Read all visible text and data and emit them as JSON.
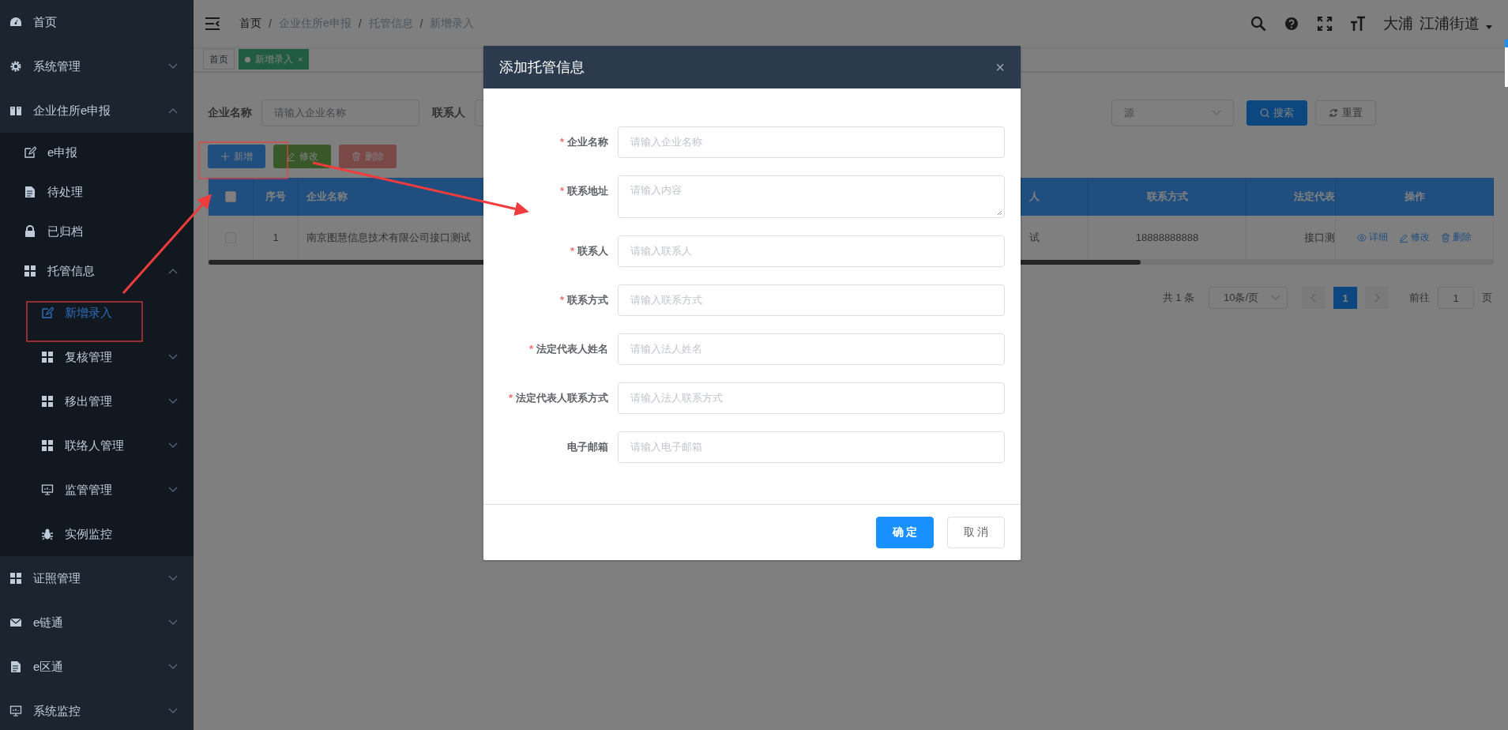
{
  "sidebar": {
    "items": [
      {
        "label": "首页",
        "selected": false
      },
      {
        "label": "系统管理",
        "selected": false,
        "expanded": false
      },
      {
        "label": "企业住所e申报",
        "selected": false,
        "expanded": true,
        "children": [
          {
            "label": "e申报",
            "selected": false
          },
          {
            "label": "待处理",
            "selected": false
          },
          {
            "label": "已归档",
            "selected": false
          },
          {
            "label": "托管信息",
            "selected": false,
            "expanded": true,
            "children": [
              {
                "label": "新增录入",
                "selected": true
              },
              {
                "label": "复核管理",
                "selected": false,
                "expanded": false
              },
              {
                "label": "移出管理",
                "selected": false,
                "expanded": false
              },
              {
                "label": "联络人管理",
                "selected": false,
                "expanded": false
              },
              {
                "label": "监管管理",
                "selected": false,
                "expanded": false
              },
              {
                "label": "实例监控",
                "selected": false
              }
            ]
          }
        ]
      },
      {
        "label": "证照管理",
        "selected": false,
        "expanded": false
      },
      {
        "label": "e链通",
        "selected": false,
        "expanded": false
      },
      {
        "label": "e区通",
        "selected": false,
        "expanded": false
      },
      {
        "label": "系统监控",
        "selected": false,
        "expanded": false
      }
    ]
  },
  "navbar": {
    "breadcrumbs": [
      "首页",
      "企业住所e申报",
      "托管信息",
      "新增录入"
    ],
    "separator": "/",
    "user": {
      "district": "大浦",
      "street": "江浦街道"
    }
  },
  "tags": [
    {
      "label": "首页",
      "selected": false
    },
    {
      "label": "新增录入",
      "selected": true,
      "close": "×"
    }
  ],
  "filters": [
    {
      "kind": "input",
      "label": "企业名称",
      "placeholder": "请输入企业名称"
    },
    {
      "kind": "input",
      "label": "联系人"
    },
    {
      "kind": "select",
      "placeholder": "源"
    }
  ],
  "filter_buttons": [
    {
      "label": "搜索",
      "kind": "primary"
    },
    {
      "label": "重置",
      "kind": "default"
    }
  ],
  "toolbar": [
    {
      "label": "新增",
      "kind": "primary",
      "disabled": false
    },
    {
      "label": "修改",
      "kind": "success",
      "disabled": true
    },
    {
      "label": "删除",
      "kind": "danger",
      "disabled": true
    }
  ],
  "table": {
    "select_all": {
      "checked": false
    },
    "columns": [
      "序号",
      "企业名称",
      "人",
      "联系方式",
      "法定代表",
      "操作"
    ],
    "rows": [
      {
        "checked": false,
        "cells": [
          "1",
          "南京图慧信息技术有限公司接口测试",
          "试",
          "18888888888",
          "接口测"
        ],
        "actions": [
          "详细",
          "修改",
          "删除"
        ]
      }
    ]
  },
  "pagination": {
    "total": "共 1 条",
    "page_size": "10条/页",
    "pages": [
      {
        "label": "1",
        "selected": true
      }
    ],
    "goto_label": "前往",
    "goto_value": "1",
    "goto_suffix": "页"
  },
  "modal": {
    "title": "添加托管信息",
    "close": "×",
    "required_mark": "*",
    "fields": [
      {
        "kind": "input",
        "label": "企业名称",
        "required": true,
        "placeholder": "请输入企业名称"
      },
      {
        "kind": "textarea",
        "label": "联系地址",
        "required": true,
        "placeholder": "请输入内容"
      },
      {
        "kind": "input",
        "label": "联系人",
        "required": true,
        "placeholder": "请输入联系人"
      },
      {
        "kind": "input",
        "label": "联系方式",
        "required": true,
        "placeholder": "请输入联系方式"
      },
      {
        "kind": "input",
        "label": "法定代表人姓名",
        "required": true,
        "placeholder": "请输入法人姓名"
      },
      {
        "kind": "input",
        "label": "法定代表人联系方式",
        "required": true,
        "placeholder": "请输入法人联系方式"
      },
      {
        "kind": "input",
        "label": "电子邮箱",
        "required": false,
        "placeholder": "请输入电子邮箱"
      }
    ],
    "buttons": [
      {
        "label": "确 定",
        "kind": "primary"
      },
      {
        "label": "取 消",
        "kind": "default"
      }
    ]
  }
}
